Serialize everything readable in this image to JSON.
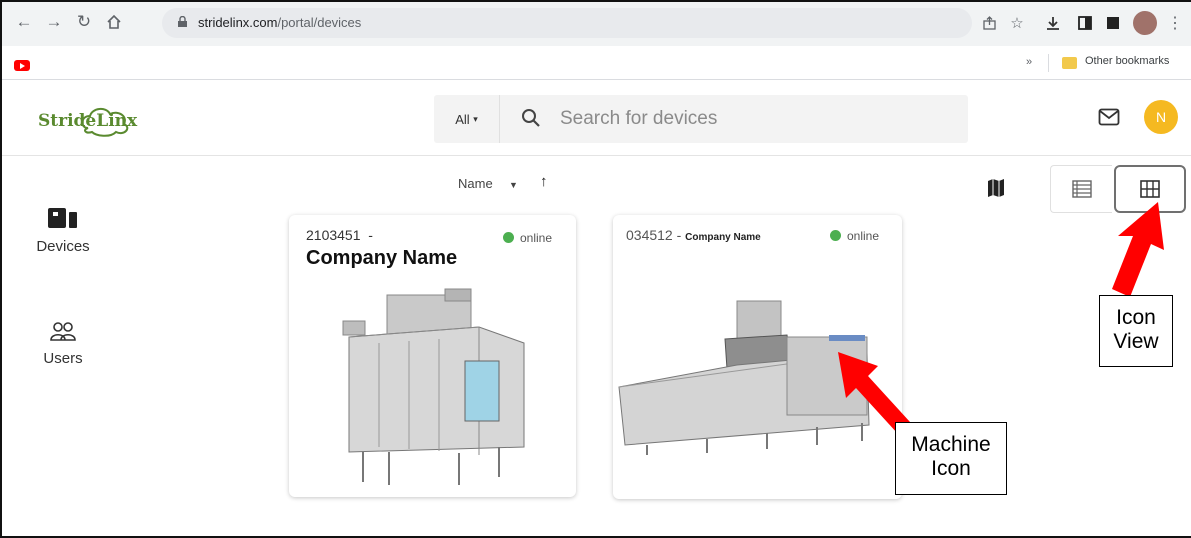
{
  "browser": {
    "url_host": "stridelinx.com",
    "url_path": "/portal/devices",
    "bookmarks_chevron": "»",
    "bookmarks_folder": "Other bookmarks"
  },
  "app": {
    "logo": "StrideLinx",
    "search": {
      "scope_label": "All",
      "placeholder": "Search for devices"
    },
    "user_initial": "N"
  },
  "sidebar": {
    "items": [
      {
        "label": "Devices"
      },
      {
        "label": "Users"
      }
    ]
  },
  "toolbar": {
    "sort_label": "Name"
  },
  "devices": [
    {
      "id": "2103451",
      "separator": "-",
      "company": "Company Name",
      "status": "online"
    },
    {
      "id": "034512",
      "separator": "-",
      "company": "Company Name",
      "status": "online"
    }
  ],
  "annotations": {
    "icon_view": [
      "Icon",
      "View"
    ],
    "machine_icon": [
      "Machine",
      "Icon"
    ]
  },
  "colors": {
    "online": "#4caf50",
    "avatar": "#f5b921",
    "arrow": "#ff0000"
  }
}
